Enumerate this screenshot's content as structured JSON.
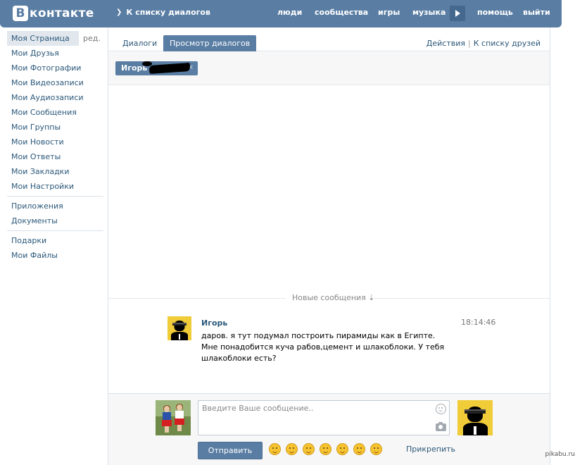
{
  "header": {
    "logo_letter": "В",
    "logo_text": "контакте",
    "back_chevron": "❯",
    "back_label": "К списку диалогов",
    "nav": [
      "люди",
      "сообщества",
      "игры",
      "музыка",
      "помощь",
      "выйти"
    ],
    "play_icon": "play-icon",
    "bg_color": "#597da3"
  },
  "sidebar": {
    "edit_label": "ред.",
    "items": [
      {
        "label": "Моя Страница"
      },
      {
        "label": "Мои Друзья"
      },
      {
        "label": "Мои Фотографии"
      },
      {
        "label": "Мои Видеозаписи"
      },
      {
        "label": "Мои Аудиозаписи"
      },
      {
        "label": "Мои Сообщения"
      },
      {
        "label": "Мои Группы"
      },
      {
        "label": "Мои Новости"
      },
      {
        "label": "Мои Ответы"
      },
      {
        "label": "Мои Закладки"
      },
      {
        "label": "Мои Настройки"
      }
    ],
    "items2": [
      {
        "label": "Приложения"
      },
      {
        "label": "Документы"
      }
    ],
    "items3": [
      {
        "label": "Подарки"
      },
      {
        "label": "Мои Файлы"
      }
    ]
  },
  "main": {
    "tabs": [
      {
        "label": "Диалоги"
      },
      {
        "label": "Просмотр диалогов"
      }
    ],
    "actions_label": "Действия",
    "pipe": "|",
    "friends_link": "К списку друзей",
    "peer_chip": {
      "name": "Игорь",
      "close": "✕"
    },
    "new_messages": "Новые сообщения ⇣"
  },
  "message": {
    "author": "Игорь",
    "time": "18:14:46",
    "text": "даров. я тут подумал построить пирамиды как в Египте. Мне понадобится куча рабов,цемент и шлакоблоки. У тебя шлакоблоки есть?"
  },
  "composer": {
    "placeholder": "Введите Ваше сообщение..",
    "send_label": "Отправить",
    "attach_label": "Прикрепить",
    "emoji_count_icons": [
      "smile-icon",
      "blush-icon",
      "unsure-icon",
      "grin-icon",
      "wink-icon",
      "sweat-icon",
      "laugh-icon"
    ]
  },
  "watermark": "pikabu.ru"
}
